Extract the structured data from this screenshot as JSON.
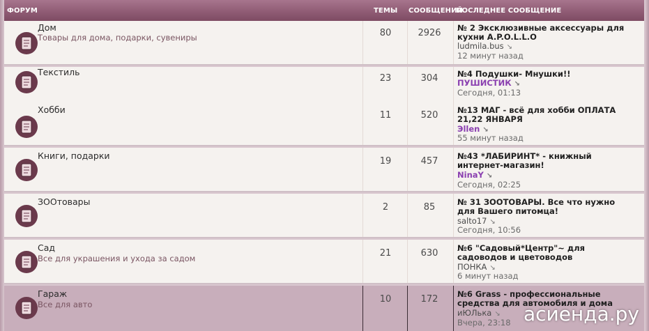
{
  "header": {
    "forum": "ФОРУМ",
    "topics": "ТЕМЫ",
    "posts": "СООБЩЕНИЙ",
    "last": "ПОСЛЕДНЕЕ СООБЩЕНИЕ"
  },
  "forums": [
    {
      "title": "Дом",
      "desc": "Товары для дома, подарки, сувениры",
      "topics": "80",
      "posts": "2926",
      "last_title": "№ 2 Эксклюзивные аксессуары для кухни A.P.O.L.L.O",
      "last_user": "ludmila.bus",
      "last_time": "12 минут назад"
    },
    {
      "title": "Текстиль",
      "desc": "",
      "topics": "23",
      "posts": "304",
      "last_title": "№4 Подушки- Мнушки!!",
      "last_user": "ПУШИСТИК",
      "last_time": "Сегодня, 01:13"
    },
    {
      "title": "Хобби",
      "desc": "",
      "topics": "11",
      "posts": "520",
      "last_title": "№13 МАГ - всё для хобби ОПЛАТА 21,22 ЯНВАРЯ",
      "last_user": "Эllen",
      "last_time": "55 минут назад"
    },
    {
      "title": "Книги, подарки",
      "desc": "",
      "topics": "19",
      "posts": "457",
      "last_title": "№43 *ЛАБИРИНТ* - книжный интернет-магазин!",
      "last_user": "NinaY",
      "last_time": "Сегодня, 02:25"
    },
    {
      "title": "ЗООтовары",
      "desc": "",
      "topics": "2",
      "posts": "85",
      "last_title": "№ 31 ЗООТОВАРЫ. Все что нужно для Вашего питомца!",
      "last_user": "salto17",
      "last_time": "Сегодня, 10:56"
    },
    {
      "title": "Сад",
      "desc": "Все для украшения и ухода за садом",
      "topics": "21",
      "posts": "630",
      "last_title": "№6 \"Садовый*Центр\"~ для садоводов и цветоводов",
      "last_user": "ПОНКА",
      "last_time": "6 минут назад"
    },
    {
      "title": "Гараж",
      "desc": "Все для авто",
      "topics": "10",
      "posts": "172",
      "last_title": "№6 Grass - профессиональные средства для автомобиля и дома",
      "last_user": "иЮЛька",
      "last_time": "Вчера, 23:18"
    }
  ],
  "watermark": "асиенда.ру",
  "colors": {
    "header": "#8e5a73",
    "row": "#f5f2ef",
    "row_hover": "#c8aebb",
    "purple_user": "#8a3fb0"
  }
}
